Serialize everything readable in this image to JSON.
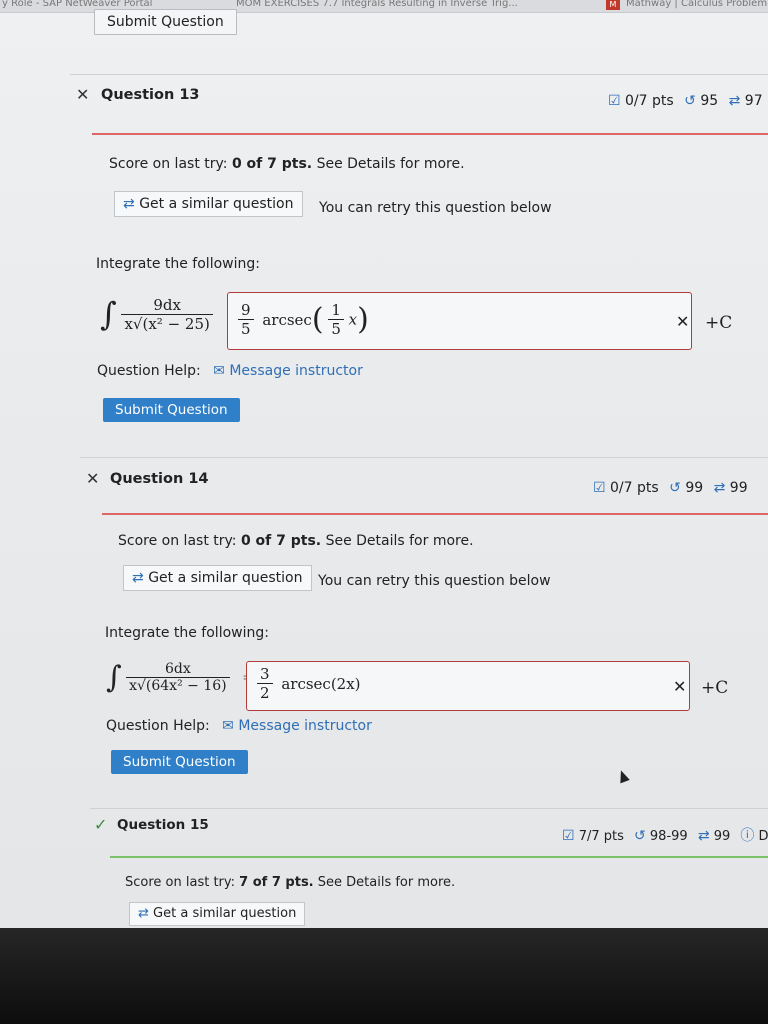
{
  "tabs": {
    "left": "y Role - SAP NetWeaver Portal",
    "middle": "MOM EXERCISES 7.7 Integrals Resulting in Inverse Trig...",
    "right": "Mathway | Calculus Problem"
  },
  "top_submit": "Submit Question",
  "questions": [
    {
      "title": "Question 13",
      "status_mark": "✕",
      "pts": "0/7 pts",
      "attempts": "95",
      "similar_count": "97",
      "score_label": "Score on last try:",
      "score_value": "0 of 7 pts.",
      "score_tail": "See Details for more.",
      "similar_btn": "Get a similar question",
      "retry_text": "You can retry this question below",
      "instruction": "Integrate the following:",
      "integrand_num": "9dx",
      "integrand_den": "x√(x² − 25)",
      "answer_coef_num": "9",
      "answer_coef_den": "5",
      "answer_func": "arcsec",
      "answer_inner_num": "1",
      "answer_inner_den": "5",
      "answer_var": "x",
      "plus_c": "+C",
      "help_label": "Question Help:",
      "help_link": "Message instructor",
      "submit": "Submit Question"
    },
    {
      "title": "Question 14",
      "status_mark": "✕",
      "pts": "0/7 pts",
      "attempts": "99",
      "similar_count": "99",
      "score_label": "Score on last try:",
      "score_value": "0 of 7 pts.",
      "score_tail": "See Details for more.",
      "similar_btn": "Get a similar question",
      "retry_text": "You can retry this question below",
      "instruction": "Integrate the following:",
      "integrand_num": "6dx",
      "integrand_den": "x√(64x² − 16)",
      "answer_coef_num": "3",
      "answer_coef_den": "2",
      "answer_func": "arcsec(2x)",
      "plus_c": "+C",
      "help_label": "Question Help:",
      "help_link": "Message instructor",
      "submit": "Submit Question"
    },
    {
      "title": "Question 15",
      "status_mark": "✓",
      "pts": "7/7 pts",
      "attempts": "98-99",
      "similar_count": "99",
      "details": "D",
      "score_label": "Score on last try:",
      "score_value": "7 of 7 pts.",
      "score_tail": "See Details for more.",
      "similar_btn": "Get a similar question"
    }
  ]
}
